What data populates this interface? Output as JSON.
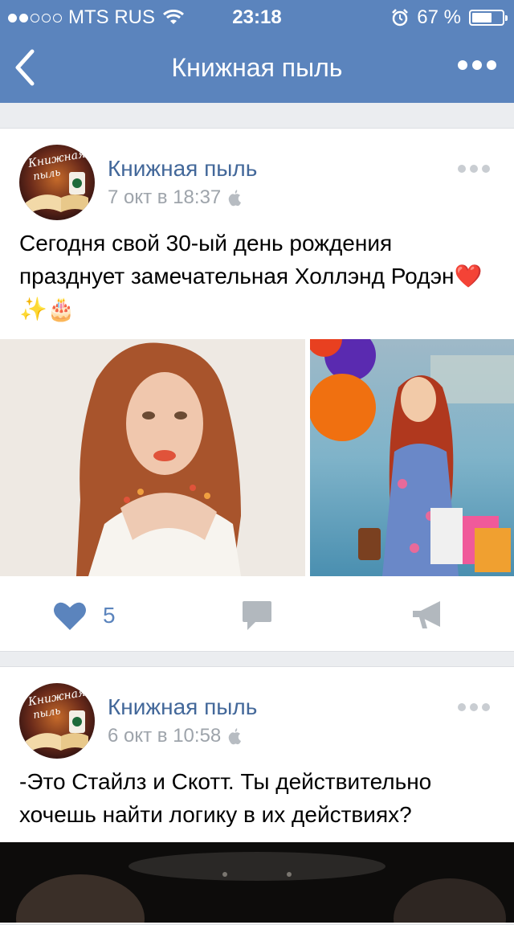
{
  "status_bar": {
    "carrier": "MTS RUS",
    "time": "23:18",
    "battery": "67 %",
    "battery_level": 0.67
  },
  "nav": {
    "title": "Книжная пыль"
  },
  "posts": [
    {
      "author": "Книжная пыль",
      "date": "7 окт в 18:37",
      "text": "Сегодня свой 30-ый день рождения празднует замечательная Холлэнд Родэн❤️✨🎂",
      "likes": "5"
    },
    {
      "author": "Книжная пыль",
      "date": "6 окт в 10:58",
      "text": "-Это Стайлз и Скотт. Ты действительно хочешь найти логику в их действиях?"
    }
  ],
  "colors": {
    "header": "#5b84bd",
    "link": "#43689a",
    "meta": "#9ea4ab"
  }
}
